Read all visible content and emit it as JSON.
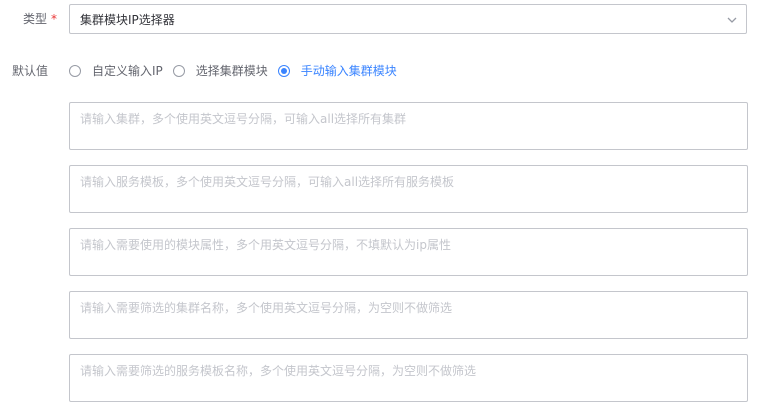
{
  "type_field": {
    "label": "类型",
    "required_mark": "*",
    "selected_value": "集群模块IP选择器",
    "icon": "chevron-down-icon"
  },
  "default_field": {
    "label": "默认值",
    "options": [
      {
        "label": "自定义输入IP",
        "checked": false
      },
      {
        "label": "选择集群模块",
        "checked": false
      },
      {
        "label": "手动输入集群模块",
        "checked": true
      }
    ]
  },
  "inputs": [
    {
      "value": "",
      "placeholder": "请输入集群，多个使用英文逗号分隔，可输入all选择所有集群"
    },
    {
      "value": "",
      "placeholder": "请输入服务模板，多个使用英文逗号分隔，可输入all选择所有服务模板"
    },
    {
      "value": "",
      "placeholder": "请输入需要使用的模块属性，多个用英文逗号分隔，不填默认为ip属性"
    },
    {
      "value": "",
      "placeholder": "请输入需要筛选的集群名称，多个使用英文逗号分隔，为空则不做筛选"
    },
    {
      "value": "",
      "placeholder": "请输入需要筛选的服务模板名称，多个使用英文逗号分隔，为空则不做筛选"
    }
  ],
  "colors": {
    "accent": "#3a84ff",
    "required": "#ea3636",
    "border": "#c4c6cc",
    "text": "#63656e"
  }
}
